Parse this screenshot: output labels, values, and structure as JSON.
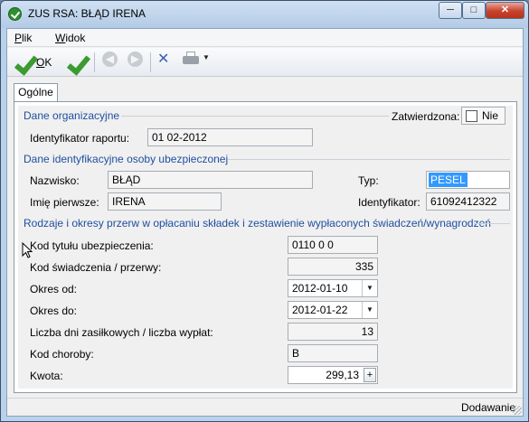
{
  "window": {
    "title": "ZUS RSA: BŁĄD IRENA",
    "minimize_glyph": "─",
    "maximize_glyph": "□",
    "close_glyph": "✕"
  },
  "menu": {
    "items": [
      {
        "label_first": "P",
        "label_rest": "lik"
      },
      {
        "label_first": "W",
        "label_rest": "idok"
      }
    ]
  },
  "toolbar": {
    "ok_first": "O",
    "ok_rest": "K",
    "icons": [
      "ok-check-icon",
      "save-check-icon",
      "back-icon",
      "forward-icon",
      "tools-icon",
      "printer-icon",
      "dropdown-arrow-icon"
    ]
  },
  "tabs": [
    {
      "label": "Ogólne",
      "active": true
    }
  ],
  "dane_organizacyjne": {
    "title": "Dane organizacyjne",
    "zatwierdzona_label": "Zatwierdzona:",
    "zatwierdzona_value": "Nie",
    "zatwierdzona_checked": false,
    "identyfikator_label": "Identyfikator raportu:",
    "identyfikator_value": "01 02-2012"
  },
  "dane_osoby": {
    "title": "Dane identyfikacyjne osoby ubezpieczonej",
    "nazwisko_label": "Nazwisko:",
    "nazwisko_value": "BŁĄD",
    "imie_label": "Imię pierwsze:",
    "imie_value": "IRENA",
    "typ_label": "Typ:",
    "typ_value": "PESEL",
    "identyfikator_label": "Identyfikator:",
    "identyfikator_value": "61092412322"
  },
  "przerwy": {
    "title": "Rodzaje i okresy przerw w opłacaniu składek i zestawienie wypłaconych świadczeń/wynagrodzeń",
    "kod_tytulu_label": "Kod tytułu ubezpieczenia:",
    "kod_tytulu_value": "0110 0 0",
    "kod_swiadczenia_label": "Kod świadczenia / przerwy:",
    "kod_swiadczenia_value": "335",
    "okres_od_label": "Okres od:",
    "okres_od_value": "2012-01-10",
    "okres_do_label": "Okres do:",
    "okres_do_value": "2012-01-22",
    "liczba_dni_label": "Liczba dni zasiłkowych / liczba wypłat:",
    "liczba_dni_value": "13",
    "kod_choroby_label": "Kod choroby:",
    "kod_choroby_value": "B",
    "kwota_label": "Kwota:",
    "kwota_value": "299,13",
    "dropdown_glyph": "▼",
    "plus_glyph": "+"
  },
  "status": {
    "text": "Dodawanie"
  },
  "colors": {
    "section_title": "#1f4fa0",
    "ok_check": "#3b9b2f",
    "selection": "#3399ff",
    "close_button": "#c7432c"
  }
}
